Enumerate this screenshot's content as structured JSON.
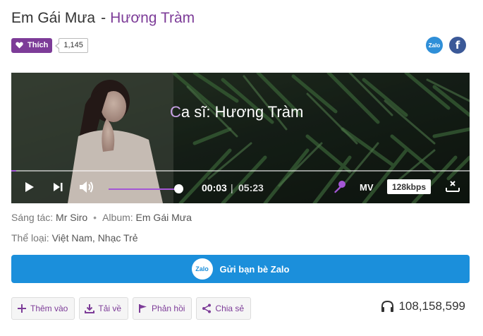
{
  "song": {
    "title": "Em Gái Mưa",
    "separator": "-",
    "artist": "Hương Tràm"
  },
  "like": {
    "label": "Thích",
    "count": "1,145"
  },
  "share_icons": {
    "zalo_label": "Zalo",
    "facebook_label": "f"
  },
  "player": {
    "caption_first": "C",
    "caption_rest": "a sĩ: Hương Tràm",
    "current_time": "00:03",
    "time_separator": "|",
    "total_time": "05:23",
    "progress_fraction": 0.01,
    "volume_fraction": 1.0,
    "mv_label": "MV",
    "quality": "128kbps"
  },
  "meta": {
    "composer_label": "Sáng tác:",
    "composer": "Mr Siro",
    "dot": "•",
    "album_label": "Album:",
    "album": "Em Gái Mưa",
    "genre_label": "Thể loại:",
    "genres": "Việt Nam, Nhạc Trẻ"
  },
  "zalo_share": {
    "badge": "Zalo",
    "label": "Gửi bạn bè Zalo"
  },
  "actions": {
    "add": "Thêm vào",
    "download": "Tải về",
    "feedback": "Phản hồi",
    "share": "Chia sẻ"
  },
  "listens": "108,158,599",
  "colors": {
    "brand_purple": "#7d3c98",
    "zalo_blue": "#1b8fdb",
    "facebook_blue": "#3b5998",
    "progress_purple": "#a557d6"
  }
}
